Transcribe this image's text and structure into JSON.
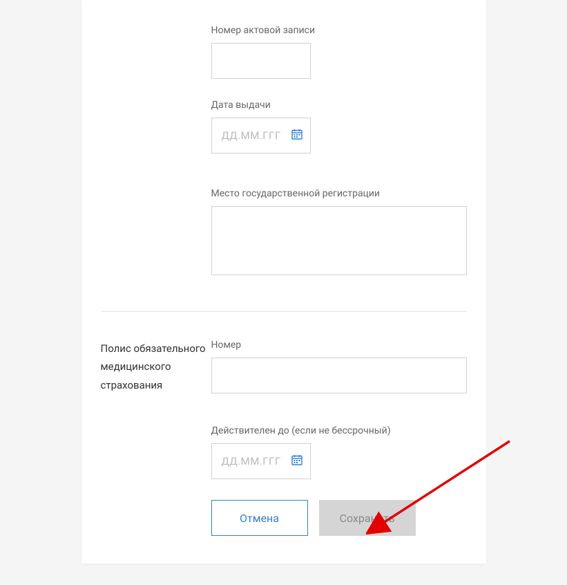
{
  "section1": {
    "record_number_label": "Номер актовой записи",
    "issue_date_label": "Дата выдачи",
    "date_placeholder": "ДД.ММ.ГГГГ",
    "registration_place_label": "Место государственной регистрации"
  },
  "section2": {
    "title": "Полис обязательного медицинского страхования",
    "number_label": "Номер",
    "valid_until_label": "Действителен до (если не бессрочный)",
    "date_placeholder": "ДД.ММ.ГГГГ"
  },
  "buttons": {
    "cancel": "Отмена",
    "save": "Сохранить"
  }
}
